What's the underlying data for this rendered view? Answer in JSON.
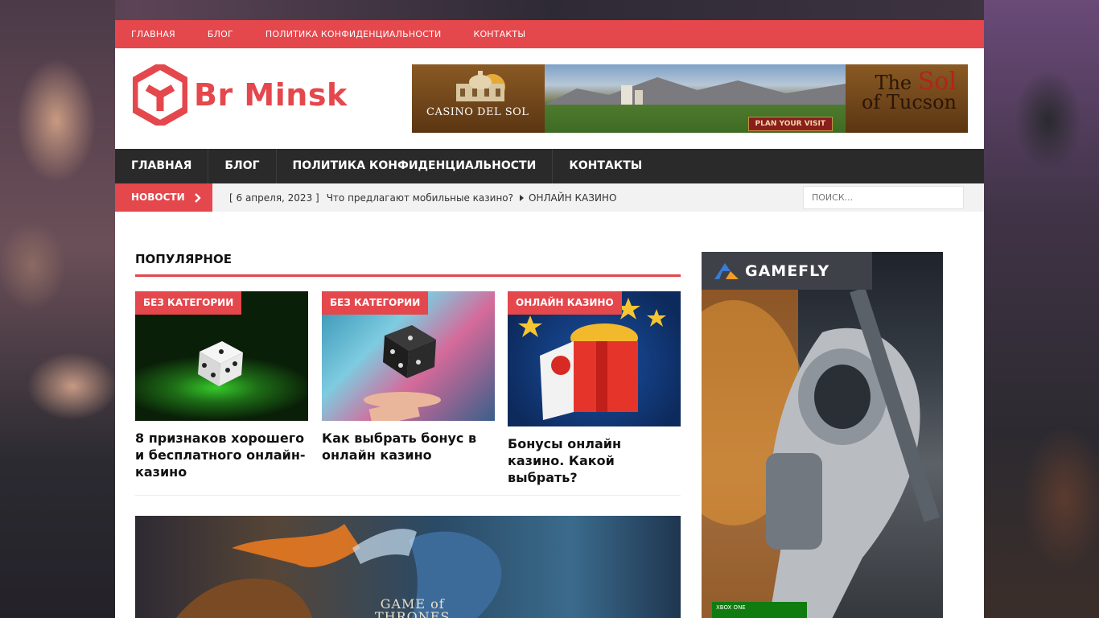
{
  "topbar": {
    "links": [
      "ГЛАВНАЯ",
      "БЛОГ",
      "ПОЛИТИКА КОНФИДЕНЦИАЛЬНОСТИ",
      "КОНТАКТЫ"
    ]
  },
  "header": {
    "logo_text": "Br Minsk",
    "banner": {
      "left_title": "CASINO DEL SOL",
      "right_the": "The",
      "right_sol": "Sol",
      "right_of": "of Tucson",
      "cta": "PLAN YOUR VISIT"
    }
  },
  "mainnav": {
    "links": [
      "ГЛАВНАЯ",
      "БЛОГ",
      "ПОЛИТИКА КОНФИДЕНЦИАЛЬНОСТИ",
      "КОНТАКТЫ"
    ]
  },
  "ticker": {
    "label": "НОВОСТИ",
    "date": "[ 6 апреля, 2023 ]",
    "title": "Что предлагают мобильные казино?",
    "category": "ОНЛАЙН КАЗИНО"
  },
  "search": {
    "placeholder": "ПОИСК..."
  },
  "popular": {
    "heading": "ПОПУЛЯРНОЕ",
    "cards": [
      {
        "category": "БЕЗ КАТЕГОРИИ",
        "title": "8 признаков хорошего и бесплатного онлайн-казино"
      },
      {
        "category": "БЕЗ КАТЕГОРИИ",
        "title": "Как выбрать бонус в онлайн казино"
      },
      {
        "category": "ОНЛАЙН КАЗИНО",
        "title": "Бонусы онлайн казино. Какой выбрать?"
      }
    ]
  },
  "feature": {
    "image_text_1": "GAME of",
    "image_text_2": "THRONES"
  },
  "sidebar_ad": {
    "brand": "GAMEFLY",
    "platform": "XBOX ONE"
  },
  "colors": {
    "accent": "#e4474c",
    "nav_bg": "#2a2a2a",
    "ticker_bg": "#f2f2f2"
  }
}
